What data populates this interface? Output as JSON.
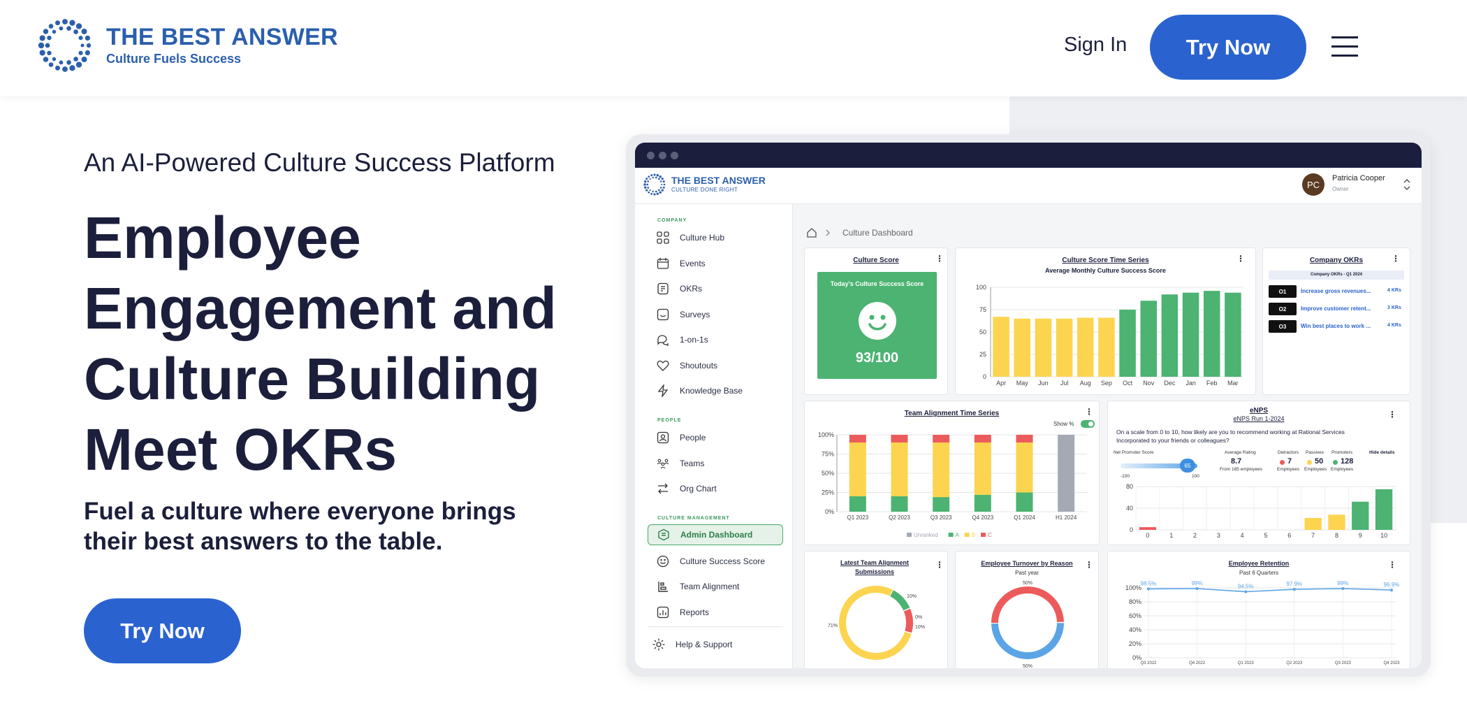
{
  "site": {
    "brand_title": "THE BEST ANSWER",
    "brand_sub": "Culture Fuels Success",
    "signin": "Sign In",
    "try_top": "Try Now",
    "tagline": "An AI-Powered Culture Success Platform",
    "headline": [
      "Employee",
      "Engagement and",
      "Culture Building",
      "Meet OKRs"
    ],
    "subhead": [
      "Fuel a culture where everyone brings",
      "their best answers to the table."
    ],
    "try_hero": "Try Now",
    "colors": {
      "brand_blue": "#2a63cf",
      "navy": "#1b1f3b",
      "green": "#4cb372",
      "yellow": "#fcd44f",
      "red": "#ec5b5b"
    }
  },
  "app": {
    "brand_title": "THE BEST ANSWER",
    "brand_sub": "CULTURE DONE RIGHT",
    "user": {
      "initials": "PC",
      "name": "Patricia Cooper",
      "role": "Owner"
    },
    "breadcrumb": "Culture Dashboard",
    "sidebar": {
      "company_label": "COMPANY",
      "company": [
        {
          "label": "Culture Hub",
          "icon": "grid-icon"
        },
        {
          "label": "Events",
          "icon": "calendar-icon"
        },
        {
          "label": "OKRs",
          "icon": "target-icon"
        },
        {
          "label": "Surveys",
          "icon": "survey-icon"
        },
        {
          "label": "1-on-1s",
          "icon": "chat-icon"
        },
        {
          "label": "Shoutouts",
          "icon": "heart-icon"
        },
        {
          "label": "Knowledge Base",
          "icon": "bolt-icon"
        }
      ],
      "people_label": "PEOPLE",
      "people": [
        {
          "label": "People",
          "icon": "person-icon"
        },
        {
          "label": "Teams",
          "icon": "team-icon"
        },
        {
          "label": "Org Chart",
          "icon": "swap-icon"
        }
      ],
      "mgmt_label": "CULTURE MANAGEMENT",
      "mgmt": [
        {
          "label": "Admin Dashboard",
          "icon": "dashboard-icon"
        },
        {
          "label": "Culture Success Score",
          "icon": "smile-icon"
        },
        {
          "label": "Team Alignment",
          "icon": "alignment-icon"
        },
        {
          "label": "Reports",
          "icon": "report-icon"
        }
      ],
      "help": "Help & Support"
    },
    "culture_score": {
      "title": "Culture Score",
      "box_label": "Today's Culture Success Score",
      "score": "93/100"
    },
    "company_okrs": {
      "title": "Company OKRs",
      "subtitle": "Company OKRs - Q1 2024",
      "items": [
        {
          "id": "O1",
          "text": "Increase gross revenues...",
          "krs": "4 KRs"
        },
        {
          "id": "O2",
          "text": "Improve customer retent...",
          "krs": "3 KRs"
        },
        {
          "id": "O3",
          "text": "Win best places to work ...",
          "krs": "4 KRs"
        }
      ]
    },
    "enps": {
      "title": "eNPS",
      "run": "eNPS Run 1-2024",
      "question": [
        "On a scale from 0 to 10, how likely are you to recommend working at Rational Services",
        "Incorporated to your friends or colleagues?"
      ],
      "nps_label": "Net Promoter Score",
      "nps_value": "65",
      "range_min": "-100",
      "range_max": "100",
      "avg_label": "Average Rating",
      "avg_value": "8.7",
      "avg_sub": "From 185 employees",
      "detractors_label": "Detractors",
      "detractors": "7",
      "passives_label": "Passives",
      "passives": "50",
      "promoters_label": "Promoters",
      "promoters": "128",
      "employees": "Employees",
      "hide": "Hide details"
    }
  },
  "chart_data": [
    {
      "type": "bar",
      "title": "Culture Score Time Series",
      "subtitle": "Average Monthly Culture Success Score",
      "categories": [
        "Apr",
        "May",
        "Jun",
        "Jul",
        "Aug",
        "Sep",
        "Oct",
        "Nov",
        "Dec",
        "Jan",
        "Feb",
        "Mar"
      ],
      "values": [
        67,
        65,
        65,
        65,
        66,
        66,
        75,
        85,
        92,
        94,
        96,
        94
      ],
      "colors": [
        "#fcd44f",
        "#fcd44f",
        "#fcd44f",
        "#fcd44f",
        "#fcd44f",
        "#fcd44f",
        "#4cb372",
        "#4cb372",
        "#4cb372",
        "#4cb372",
        "#4cb372",
        "#4cb372"
      ],
      "ylim": [
        0,
        100
      ],
      "yticks": [
        0,
        25,
        50,
        75,
        100
      ]
    },
    {
      "type": "bar",
      "title": "Team Alignment Time Series",
      "toggle_label": "Show %",
      "categories": [
        "Q1 2023",
        "Q2 2023",
        "Q3 2023",
        "Q4 2023",
        "Q1 2024",
        "H1 2024"
      ],
      "series": [
        {
          "name": "Unranked",
          "color": "#a3aab4",
          "values": [
            0,
            0,
            0,
            0,
            0,
            100
          ]
        },
        {
          "name": "A",
          "color": "#4cb372",
          "values": [
            20,
            20,
            19,
            22,
            25,
            0
          ]
        },
        {
          "name": "B",
          "color": "#fcd44f",
          "values": [
            70,
            70,
            71,
            68,
            65,
            0
          ]
        },
        {
          "name": "C",
          "color": "#ec5b5b",
          "values": [
            10,
            10,
            10,
            10,
            10,
            0
          ]
        }
      ],
      "yticks": [
        "0%",
        "25%",
        "50%",
        "75%",
        "100%"
      ]
    },
    {
      "type": "bar",
      "title": "eNPS",
      "categories": [
        "0",
        "1",
        "2",
        "3",
        "4",
        "5",
        "6",
        "7",
        "8",
        "9",
        "10"
      ],
      "values": [
        5,
        0,
        0,
        0,
        0,
        0,
        0,
        22,
        28,
        52,
        75
      ],
      "colors": [
        "#ec5b5b",
        "#ec5b5b",
        "#ec5b5b",
        "#ec5b5b",
        "#ec5b5b",
        "#ec5b5b",
        "#ec5b5b",
        "#fcd44f",
        "#fcd44f",
        "#4cb372",
        "#4cb372"
      ],
      "ylim": [
        0,
        80
      ],
      "yticks": [
        0,
        40,
        80
      ]
    },
    {
      "type": "pie",
      "title": "Latest Team Alignment Submissions",
      "slices": [
        {
          "label": "10%",
          "value": 10,
          "color": "#ec5b5b"
        },
        {
          "label": "0%",
          "value": 0,
          "color": "#a3aab4"
        },
        {
          "label": "10%",
          "value": 10,
          "color": "#4cb372"
        },
        {
          "label": "71%",
          "value": 71,
          "color": "#fcd44f"
        }
      ]
    },
    {
      "type": "pie",
      "title": "Employee Turnover by Reason",
      "subtitle": "Past year",
      "slices": [
        {
          "label": "50%",
          "value": 50,
          "color": "#ec5b5b"
        },
        {
          "label": "50%",
          "value": 50,
          "color": "#5ba4e6"
        }
      ]
    },
    {
      "type": "line",
      "title": "Employee Retention",
      "subtitle": "Past 6 Quarters",
      "x": [
        "Q3 2022",
        "Q4 2022",
        "Q1 2023",
        "Q2 2023",
        "Q3 2023",
        "Q4 2023"
      ],
      "values": [
        98.5,
        99,
        94.5,
        97.9,
        99,
        96.9
      ],
      "labels": [
        "98.5%",
        "99%",
        "94.5%",
        "97.9%",
        "99%",
        "96.9%"
      ],
      "yticks": [
        "0%",
        "20%",
        "40%",
        "60%",
        "80%",
        "100%"
      ],
      "ylim": [
        0,
        100
      ]
    }
  ]
}
